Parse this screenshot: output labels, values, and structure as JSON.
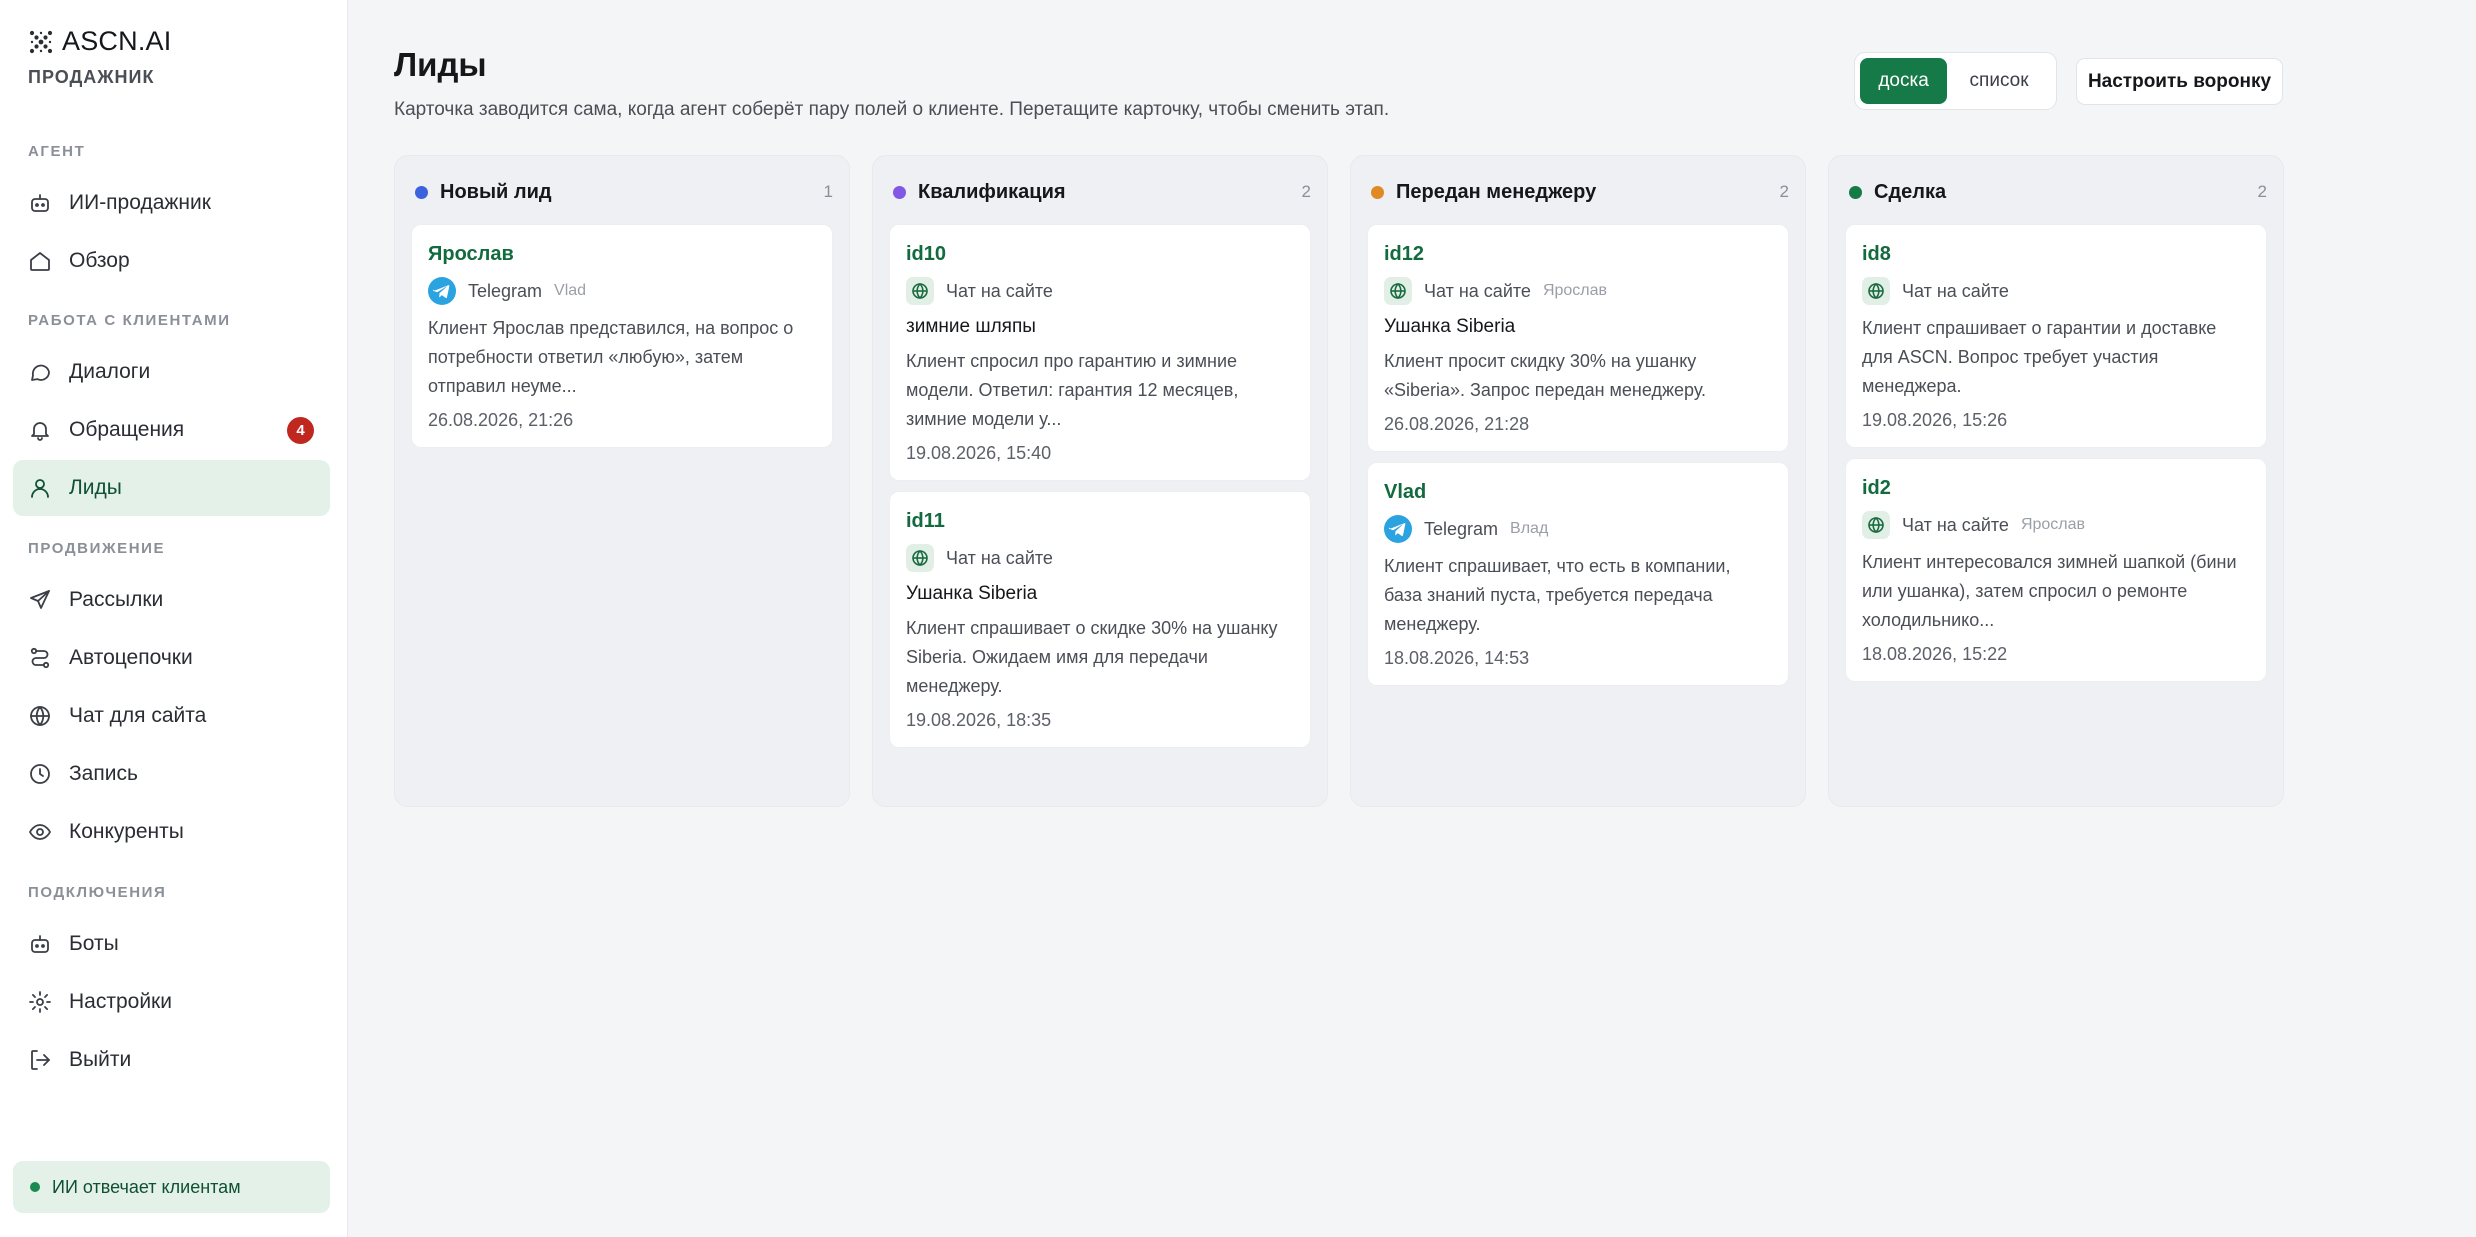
{
  "brand": {
    "name": "ASCN.AI",
    "subtitle": "ПРОДАЖНИК"
  },
  "sidebar": {
    "sections": [
      {
        "label": "АГЕНТ"
      },
      {
        "label": "РАБОТА С КЛИЕНТАМИ"
      },
      {
        "label": "ПРОДВИЖЕНИЕ"
      },
      {
        "label": "ПОДКЛЮЧЕНИЯ"
      }
    ],
    "items": [
      {
        "label": "ИИ-продажник",
        "icon": "bot-icon"
      },
      {
        "label": "Обзор",
        "icon": "home-icon"
      },
      {
        "label": "Диалоги",
        "icon": "chat-bubble-icon"
      },
      {
        "label": "Обращения",
        "icon": "bell-icon",
        "badge": "4"
      },
      {
        "label": "Лиды",
        "icon": "user-icon",
        "active": true
      },
      {
        "label": "Рассылки",
        "icon": "send-icon"
      },
      {
        "label": "Автоцепочки",
        "icon": "route-icon"
      },
      {
        "label": "Чат для сайта",
        "icon": "globe-icon"
      },
      {
        "label": "Запись",
        "icon": "clock-icon"
      },
      {
        "label": "Конкуренты",
        "icon": "eye-icon"
      },
      {
        "label": "Боты",
        "icon": "bot-icon"
      },
      {
        "label": "Настройки",
        "icon": "gear-icon"
      },
      {
        "label": "Выйти",
        "icon": "logout-icon"
      }
    ],
    "status": "ИИ отвечает клиентам"
  },
  "page": {
    "title": "Лиды",
    "description": "Карточка заводится сама, когда агент соберёт пару полей о клиенте. Перетащите карточку, чтобы сменить этап.",
    "view_toggle": {
      "board": "доска",
      "list": "список",
      "selected": "доска"
    },
    "funnel_button": "Настроить воронку"
  },
  "colors": {
    "accent": "#157a48",
    "new_lead": "#3b63e0",
    "qualification": "#8257e5",
    "manager": "#e08a25",
    "deal": "#157a48",
    "badge": "#c0281f"
  },
  "board": {
    "columns": [
      {
        "title": "Новый лид",
        "count": "1",
        "cards": [
          {
            "name": "Ярослав",
            "channel": "Telegram",
            "agent": "Vlad",
            "text": "Клиент Ярослав представился, на вопрос о потребности ответил «любую», затем отправил неуме...",
            "date": "26.08.2026, 21:26"
          }
        ]
      },
      {
        "title": "Квалификация",
        "count": "2",
        "cards": [
          {
            "name": "id10",
            "channel": "Чат на сайте",
            "subject": "зимние шляпы",
            "text": "Клиент спросил про гарантию и зимние модели. Ответил: гарантия 12 месяцев, зимние модели у...",
            "date": "19.08.2026, 15:40"
          },
          {
            "name": "id11",
            "channel": "Чат на сайте",
            "subject": "Ушанка Siberia",
            "text": "Клиент спрашивает о скидке 30% на ушанку Siberia. Ожидаем имя для передачи менеджеру.",
            "date": "19.08.2026, 18:35"
          }
        ]
      },
      {
        "title": "Передан менеджеру",
        "count": "2",
        "cards": [
          {
            "name": "id12",
            "channel": "Чат на сайте",
            "agent": "Ярослав",
            "subject": "Ушанка Siberia",
            "text": "Клиент просит скидку 30% на ушанку «Siberia». Запрос передан менеджеру.",
            "date": "26.08.2026, 21:28"
          },
          {
            "name": "Vlad",
            "channel": "Telegram",
            "agent": "Влад",
            "text": "Клиент спрашивает, что есть в компании, база знаний пуста, требуется передача менеджеру.",
            "date": "18.08.2026, 14:53"
          }
        ]
      },
      {
        "title": "Сделка",
        "count": "2",
        "cards": [
          {
            "name": "id8",
            "channel": "Чат на сайте",
            "text": "Клиент спрашивает о гарантии и доставке для ASCN. Вопрос требует участия менеджера.",
            "date": "19.08.2026, 15:26"
          },
          {
            "name": "id2",
            "channel": "Чат на сайте",
            "agent": "Ярослав",
            "text": "Клиент интересовался зимней шапкой (бини или ушанка), затем спросил о ремонте холодильнико...",
            "date": "18.08.2026, 15:22"
          }
        ]
      }
    ]
  }
}
